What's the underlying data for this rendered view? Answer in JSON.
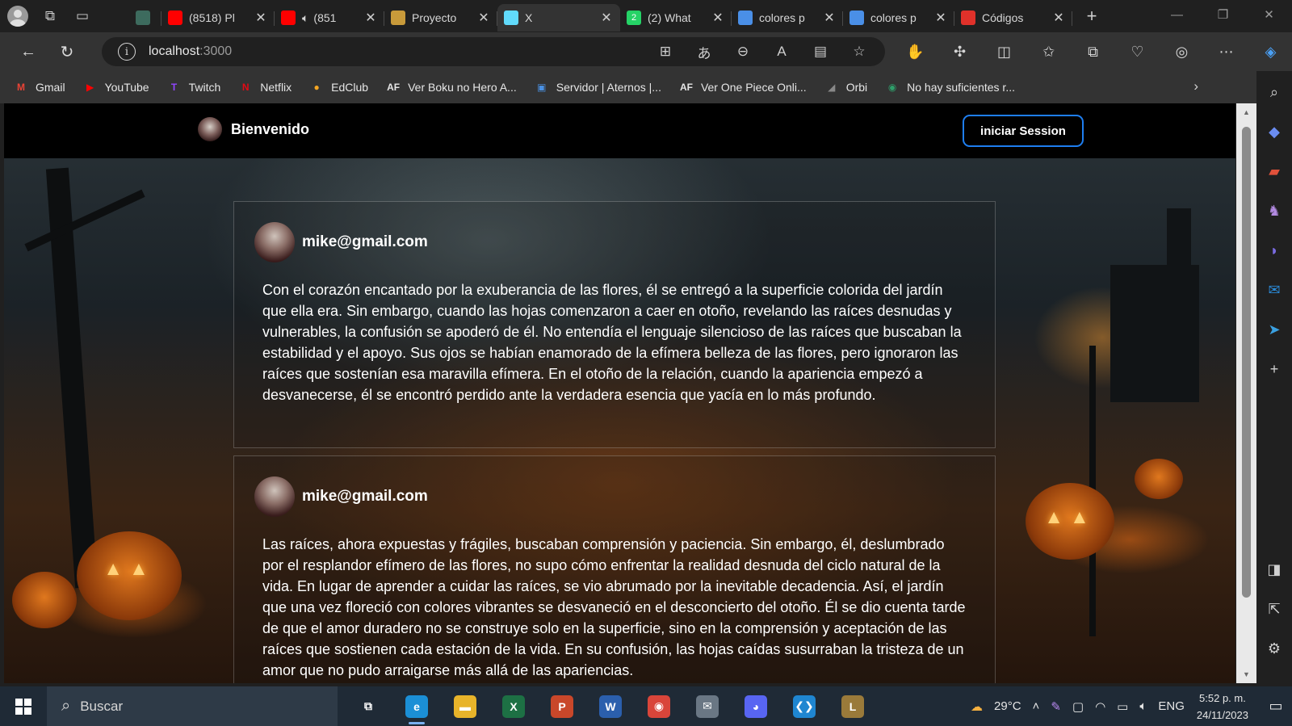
{
  "browser": {
    "tabs": [
      {
        "title": "",
        "favicon": "tab-favicon-gray",
        "color": "#3d6b5e"
      },
      {
        "title": "(8518) Pl",
        "favicon": "youtube-icon",
        "color": "#ff0000"
      },
      {
        "title": "(851",
        "favicon": "youtube-icon",
        "color": "#ff0000",
        "audio": true
      },
      {
        "title": "Proyecto",
        "favicon": "drive-icon",
        "color": "#c89a3a"
      },
      {
        "title": "X",
        "favicon": "react-icon",
        "color": "#61dafb",
        "active": true
      },
      {
        "title": "(2) What",
        "favicon": "whatsapp-icon",
        "color": "#25d366",
        "badge": "2"
      },
      {
        "title": "colores p",
        "favicon": "search-icon",
        "color": "#4a8fe7"
      },
      {
        "title": "colores p",
        "favicon": "search-icon",
        "color": "#4a8fe7"
      },
      {
        "title": "Códigos",
        "favicon": "recording-icon",
        "color": "#e0312a"
      }
    ],
    "url_host": "localhost",
    "url_port": ":3000",
    "bookmarks": [
      {
        "label": "Gmail",
        "icon": "gmail-icon",
        "color": "#ea4335",
        "glyph": "M"
      },
      {
        "label": "YouTube",
        "icon": "youtube-icon",
        "color": "#ff0000",
        "glyph": "▶"
      },
      {
        "label": "Twitch",
        "icon": "twitch-icon",
        "color": "#9146ff",
        "glyph": "T"
      },
      {
        "label": "Netflix",
        "icon": "netflix-icon",
        "color": "#e50914",
        "glyph": "N"
      },
      {
        "label": "EdClub",
        "icon": "edclub-icon",
        "color": "#f5a623",
        "glyph": "●"
      },
      {
        "label": "Ver Boku no Hero A...",
        "icon": "animeflv-icon",
        "color": "#e6e6e6",
        "glyph": "AF"
      },
      {
        "label": "Servidor | Aternos |...",
        "icon": "aternos-icon",
        "color": "#4a90e2",
        "glyph": "▣"
      },
      {
        "label": "Ver One Piece Onli...",
        "icon": "animeflv-icon",
        "color": "#e6e6e6",
        "glyph": "AF"
      },
      {
        "label": "Orbi",
        "icon": "orbi-icon",
        "color": "#888888",
        "glyph": "◢"
      },
      {
        "label": "No hay suficientes r...",
        "icon": "generic-site-icon",
        "color": "#2e9e6a",
        "glyph": "◉"
      }
    ]
  },
  "site": {
    "brand_title": "Bienvenido",
    "login_label": "iniciar Session",
    "accent_color": "#1e7ef0"
  },
  "posts": [
    {
      "author": "mike@gmail.com",
      "body": "Con el corazón encantado por la exuberancia de las flores, él se entregó a la superficie colorida del jardín que ella era. Sin embargo, cuando las hojas comenzaron a caer en otoño, revelando las raíces desnudas y vulnerables, la confusión se apoderó de él. No entendía el lenguaje silencioso de las raíces que buscaban la estabilidad y el apoyo. Sus ojos se habían enamorado de la efímera belleza de las flores, pero ignoraron las raíces que sostenían esa maravilla efímera. En el otoño de la relación, cuando la apariencia empezó a desvanecerse, él se encontró perdido ante la verdadera esencia que yacía en lo más profundo."
    },
    {
      "author": "mike@gmail.com",
      "body": "Las raíces, ahora expuestas y frágiles, buscaban comprensión y paciencia. Sin embargo, él, deslumbrado por el resplandor efímero de las flores, no supo cómo enfrentar la realidad desnuda del ciclo natural de la vida. En lugar de aprender a cuidar las raíces, se vio abrumado por la inevitable decadencia. Así, el jardín que una vez floreció con colores vibrantes se desvaneció en el desconcierto del otoño. Él se dio cuenta tarde de que el amor duradero no se construye solo en la superficie, sino en la comprensión y aceptación de las raíces que sostienen cada estación de la vida. En su confusión, las hojas caídas susurraban la tristeza de un amor que no pudo arraigarse más allá de las apariencias."
    }
  ],
  "taskbar": {
    "search_placeholder": "Buscar",
    "weather": "29°C",
    "language": "ENG",
    "time": "5:52 p. m.",
    "date": "24/11/2023",
    "apps": [
      {
        "name": "task-view-icon",
        "glyph": "⧉",
        "color": "transparent"
      },
      {
        "name": "edge-icon",
        "glyph": "e",
        "color": "#1b8fd6",
        "running": true
      },
      {
        "name": "file-explorer-icon",
        "glyph": "▬",
        "color": "#e8b42a"
      },
      {
        "name": "excel-icon",
        "glyph": "X",
        "color": "#1d7044"
      },
      {
        "name": "powerpoint-icon",
        "glyph": "P",
        "color": "#c9472a"
      },
      {
        "name": "word-icon",
        "glyph": "W",
        "color": "#2b5fad"
      },
      {
        "name": "chrome-icon",
        "glyph": "◉",
        "color": "#d9453a"
      },
      {
        "name": "mail-icon",
        "glyph": "✉",
        "color": "#6a7784"
      },
      {
        "name": "discord-icon",
        "glyph": "◕",
        "color": "#5865f2"
      },
      {
        "name": "vscode-icon",
        "glyph": "❮❯",
        "color": "#1f86d1"
      },
      {
        "name": "league-icon",
        "glyph": "L",
        "color": "#9a7a3a"
      }
    ]
  }
}
